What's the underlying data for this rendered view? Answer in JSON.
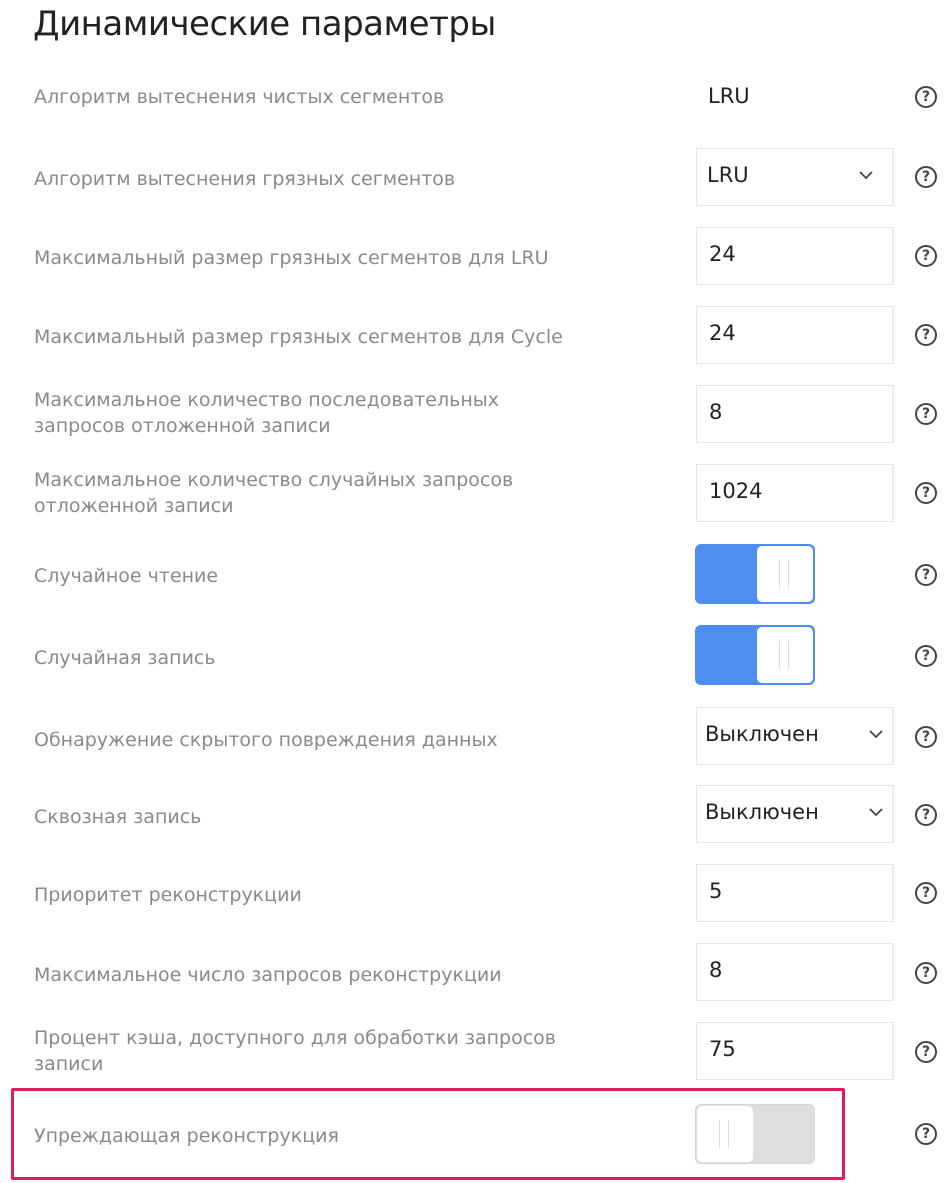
{
  "page": {
    "title": "Динамические параметры"
  },
  "params": {
    "clean_eviction": {
      "label": "Алгоритм вытеснения чистых сегментов",
      "value": "LRU"
    },
    "dirty_eviction": {
      "label": "Алгоритм вытеснения грязных сегментов",
      "value": "LRU"
    },
    "max_dirty_lru": {
      "label": "Максимальный размер грязных сегментов для LRU",
      "value": "24"
    },
    "max_dirty_cycle": {
      "label": "Максимальный размер грязных сегментов для Cycle",
      "value": "24"
    },
    "max_seq_writeback": {
      "label_line1": "Максимальное количество последовательных",
      "label_line2": "запросов отложенной записи",
      "value": "8"
    },
    "max_rand_writeback": {
      "label_line1": "Максимальное количество случайных запросов",
      "label_line2": "отложенной записи",
      "value": "1024"
    },
    "random_read": {
      "label": "Случайное чтение",
      "enabled": true
    },
    "random_write": {
      "label": "Случайная запись",
      "enabled": true
    },
    "silent_corruption": {
      "label": "Обнаружение скрытого повреждения данных",
      "value": "Выключен"
    },
    "write_through": {
      "label": "Сквозная запись",
      "value": "Выключен"
    },
    "rebuild_priority": {
      "label": "Приоритет реконструкции",
      "value": "5"
    },
    "max_rebuild_requests": {
      "label": "Максимальное число запросов реконструкции",
      "value": "8"
    },
    "cache_write_percent": {
      "label_line1": "Процент кэша, доступного для обработки запросов",
      "label_line2": "записи",
      "value": "75"
    },
    "proactive_rebuild": {
      "label": "Упреждающая реконструкция",
      "enabled": false
    }
  },
  "icons": {
    "help": "question-circle-icon",
    "chevron": "chevron-down-icon"
  },
  "colors": {
    "toggle_on": "#4d8ef0",
    "toggle_off": "#dedede",
    "highlight": "#e01a63",
    "label": "#8a8a8a"
  }
}
